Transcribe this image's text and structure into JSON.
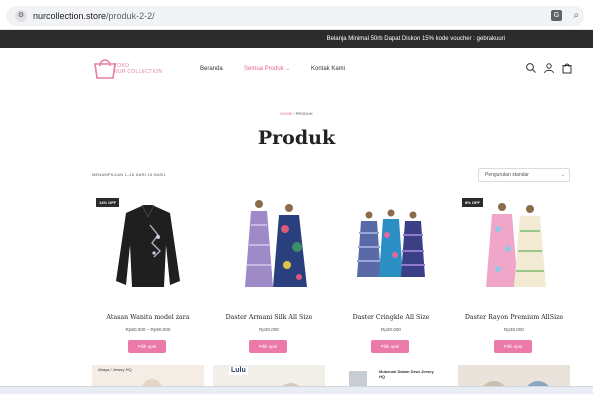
{
  "browser": {
    "url_host": "nurcollection.store",
    "url_path": "/produk-2-2/",
    "site_info_icon": "tune-icon",
    "translate_icon_glyph": "G",
    "zoom_icon_glyph": "⌕"
  },
  "announcement": {
    "text": "Belanja Minimal 50rb Dapat Diskon 15% kode voucher : gebrakuuri"
  },
  "header": {
    "logo_line1": "TOKO",
    "logo_line2": "NUR COLLECTION",
    "brand_color": "#e5669a",
    "nav": [
      {
        "label": "Beranda",
        "active": false
      },
      {
        "label": "Semua Produk",
        "active": true,
        "chevron": "⌄"
      },
      {
        "label": "Kontak Kami",
        "active": false
      }
    ],
    "icons": [
      "search-icon",
      "account-icon",
      "cart-icon"
    ]
  },
  "breadcrumb": {
    "home": "HOME",
    "separator": "/",
    "current": "PRODUK"
  },
  "page_title": "Produk",
  "results": {
    "count_text": "MENAMPILKAN 1–16 DARI 15 HASIL",
    "sort_label": "Pengurutan standar",
    "sort_chevron": "⌄"
  },
  "products": [
    {
      "name": "Atasan Wanita model zara",
      "price": "Rp80.000 – Rp90.000",
      "badge": "14% OFF",
      "button": "Pilih opsi"
    },
    {
      "name": "Daster Armani Silk All Size",
      "price": "Rp30.000",
      "badge": "",
      "button": "Pilih opsi"
    },
    {
      "name": "Daster Cringkle All Size",
      "price": "Rp30.000",
      "badge": "",
      "button": "Pilih opsi"
    },
    {
      "name": "Daster Rayon Premium AllSize",
      "price": "Rp30.000",
      "badge": "8% OFF",
      "button": "Pilih opsi"
    }
  ],
  "row2": [
    {
      "text": "Abaya / Jersey HQ"
    },
    {
      "text": "Lulu"
    },
    {
      "text": "Mukenah Dalam Dewi Jersey HQ"
    },
    {
      "text": ""
    }
  ]
}
